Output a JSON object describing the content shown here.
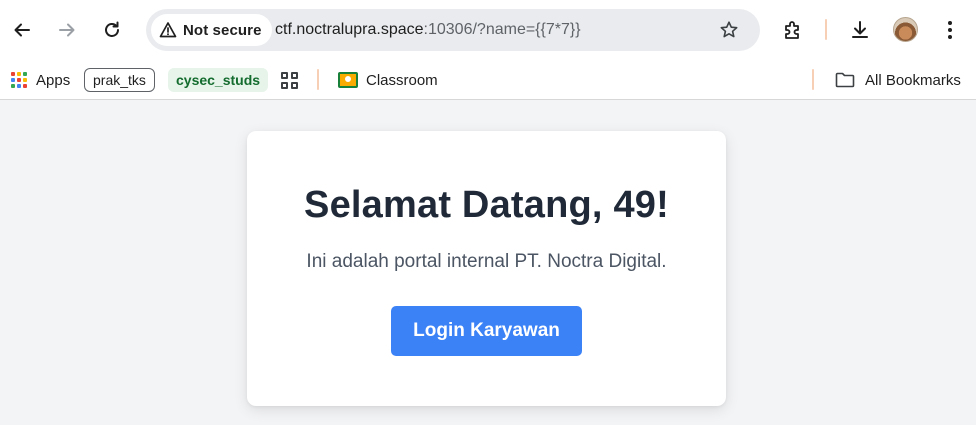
{
  "browser": {
    "security_label": "Not secure",
    "url_host": "ctf.noctralupra.space",
    "url_rest": ":10306/?name={{7*7}}",
    "icons": [
      "back-icon",
      "forward-icon",
      "reload-icon",
      "warning-icon",
      "star-icon",
      "extensions-icon",
      "download-icon",
      "avatar",
      "menu-icon"
    ]
  },
  "bookmarks": {
    "apps_label": "Apps",
    "items": [
      {
        "label": "prak_tks"
      },
      {
        "label": "cysec_studs"
      },
      {
        "label": "Classroom"
      }
    ],
    "all_bookmarks_label": "All Bookmarks"
  },
  "page": {
    "heading": "Selamat Datang, 49!",
    "subtitle": "Ini adalah portal internal PT. Noctra Digital.",
    "login_label": "Login Karyawan"
  },
  "colors": {
    "background": "#f3f4f6",
    "button": "#3b82f6",
    "heading": "#1f2937",
    "chip_green_bg": "#e6f4ea",
    "chip_green_text": "#146c2e"
  }
}
